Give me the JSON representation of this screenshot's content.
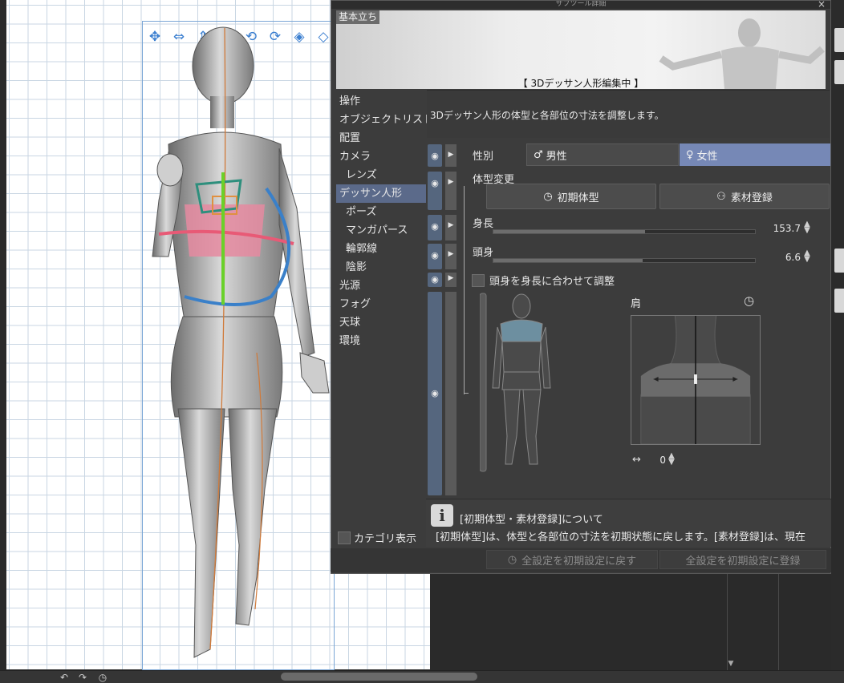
{
  "dialog": {
    "title": "サブツール詳細",
    "close": "×",
    "preview_tag": "基本立ち",
    "preview_label": "【 3Dデッサン人形編集中 】"
  },
  "categories": [
    {
      "label": "操作",
      "sub": false,
      "selected": false
    },
    {
      "label": "オブジェクトリスト",
      "sub": false,
      "selected": false
    },
    {
      "label": "配置",
      "sub": false,
      "selected": false
    },
    {
      "label": "カメラ",
      "sub": false,
      "selected": false
    },
    {
      "label": "レンズ",
      "sub": true,
      "selected": false
    },
    {
      "label": "デッサン人形",
      "sub": false,
      "selected": true
    },
    {
      "label": "ポーズ",
      "sub": true,
      "selected": false
    },
    {
      "label": "マンガパース",
      "sub": true,
      "selected": false
    },
    {
      "label": "輪郭線",
      "sub": true,
      "selected": false
    },
    {
      "label": "陰影",
      "sub": true,
      "selected": false
    },
    {
      "label": "光源",
      "sub": false,
      "selected": false
    },
    {
      "label": "フォグ",
      "sub": false,
      "selected": false
    },
    {
      "label": "天球",
      "sub": false,
      "selected": false
    },
    {
      "label": "環境",
      "sub": false,
      "selected": false
    }
  ],
  "category_toggle": "カテゴリ表示",
  "panel": {
    "description": "3Dデッサン人形の体型と各部位の寸法を調整します。",
    "gender_label": "性別",
    "male": "男性",
    "female": "女性",
    "body_change_label": "体型変更",
    "initial_body": "初期体型",
    "register_material": "素材登録",
    "height_label": "身長",
    "height_value": "153.7",
    "height_fill": 0.58,
    "heads_label": "頭身",
    "heads_value": "6.6",
    "heads_fill": 0.57,
    "fit_heads_label": "頭身を身長に合わせて調整",
    "shoulder_label": "肩",
    "shoulder_value": "0",
    "width_icon": "↔"
  },
  "info": {
    "title": "[初期体型・素材登録]について",
    "body": "[初期体型]は、体型と各部位の寸法を初期状態に戻します。[素材登録]は、現在"
  },
  "footer": {
    "reset": "全設定を初期設定に戻す",
    "register": "全設定を初期設定に登録"
  },
  "colors": {
    "selected_bg": "#5b6a8a",
    "female_bg": "#7688b6",
    "gizmo": "#3b7fd0"
  },
  "gizmo_icons": [
    "move-xy-icon",
    "move-x-icon",
    "move-z-icon",
    "move-view-icon",
    "rotate-icon",
    "rotate-y-icon",
    "rotate-z-icon",
    "rotate-all-icon"
  ]
}
